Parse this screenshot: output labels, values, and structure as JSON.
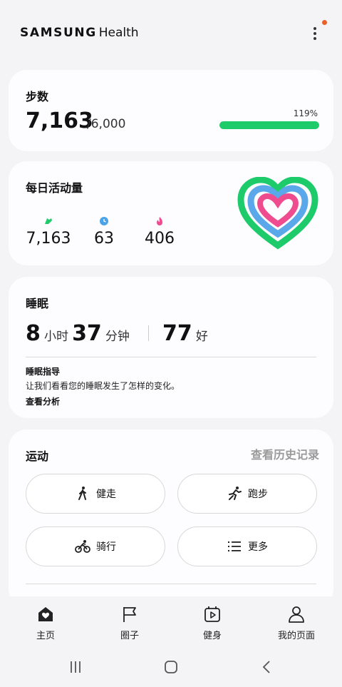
{
  "header": {
    "brand_samsung": "SAMSUNG",
    "brand_health": "Health",
    "more_icon": "more-vertical-icon",
    "notification_color": "#e8612c"
  },
  "steps": {
    "title": "步数",
    "value": "7,163",
    "goal": "/6,000",
    "percent_label": "119%",
    "progress_fraction": 1.0,
    "accent": "#1dcb6b"
  },
  "activity": {
    "title": "每日活动量",
    "steps_value": "7,163",
    "minutes_value": "63",
    "calories_value": "406",
    "colors": {
      "steps": "#1dcb6b",
      "minutes": "#4aa3e8",
      "calories": "#ef4c8f"
    }
  },
  "sleep": {
    "title": "睡眠",
    "hours": "8",
    "hours_unit": "小时",
    "minutes": "37",
    "minutes_unit": "分钟",
    "score": "77",
    "score_label": "好",
    "guide_title": "睡眠指导",
    "guide_text": "让我们看看您的睡眠发生了怎样的变化。",
    "guide_link": "查看分析"
  },
  "exercise": {
    "title": "运动",
    "history_link": "查看历史记录",
    "buttons": [
      {
        "label": "健走",
        "icon": "walking-icon"
      },
      {
        "label": "跑步",
        "icon": "running-icon"
      },
      {
        "label": "骑行",
        "icon": "cycling-icon"
      },
      {
        "label": "更多",
        "icon": "list-icon"
      }
    ]
  },
  "bottom_nav": [
    {
      "label": "主页",
      "icon": "home-heart-icon"
    },
    {
      "label": "圈子",
      "icon": "flag-icon"
    },
    {
      "label": "健身",
      "icon": "fitness-video-icon"
    },
    {
      "label": "我的页面",
      "icon": "person-icon"
    }
  ]
}
